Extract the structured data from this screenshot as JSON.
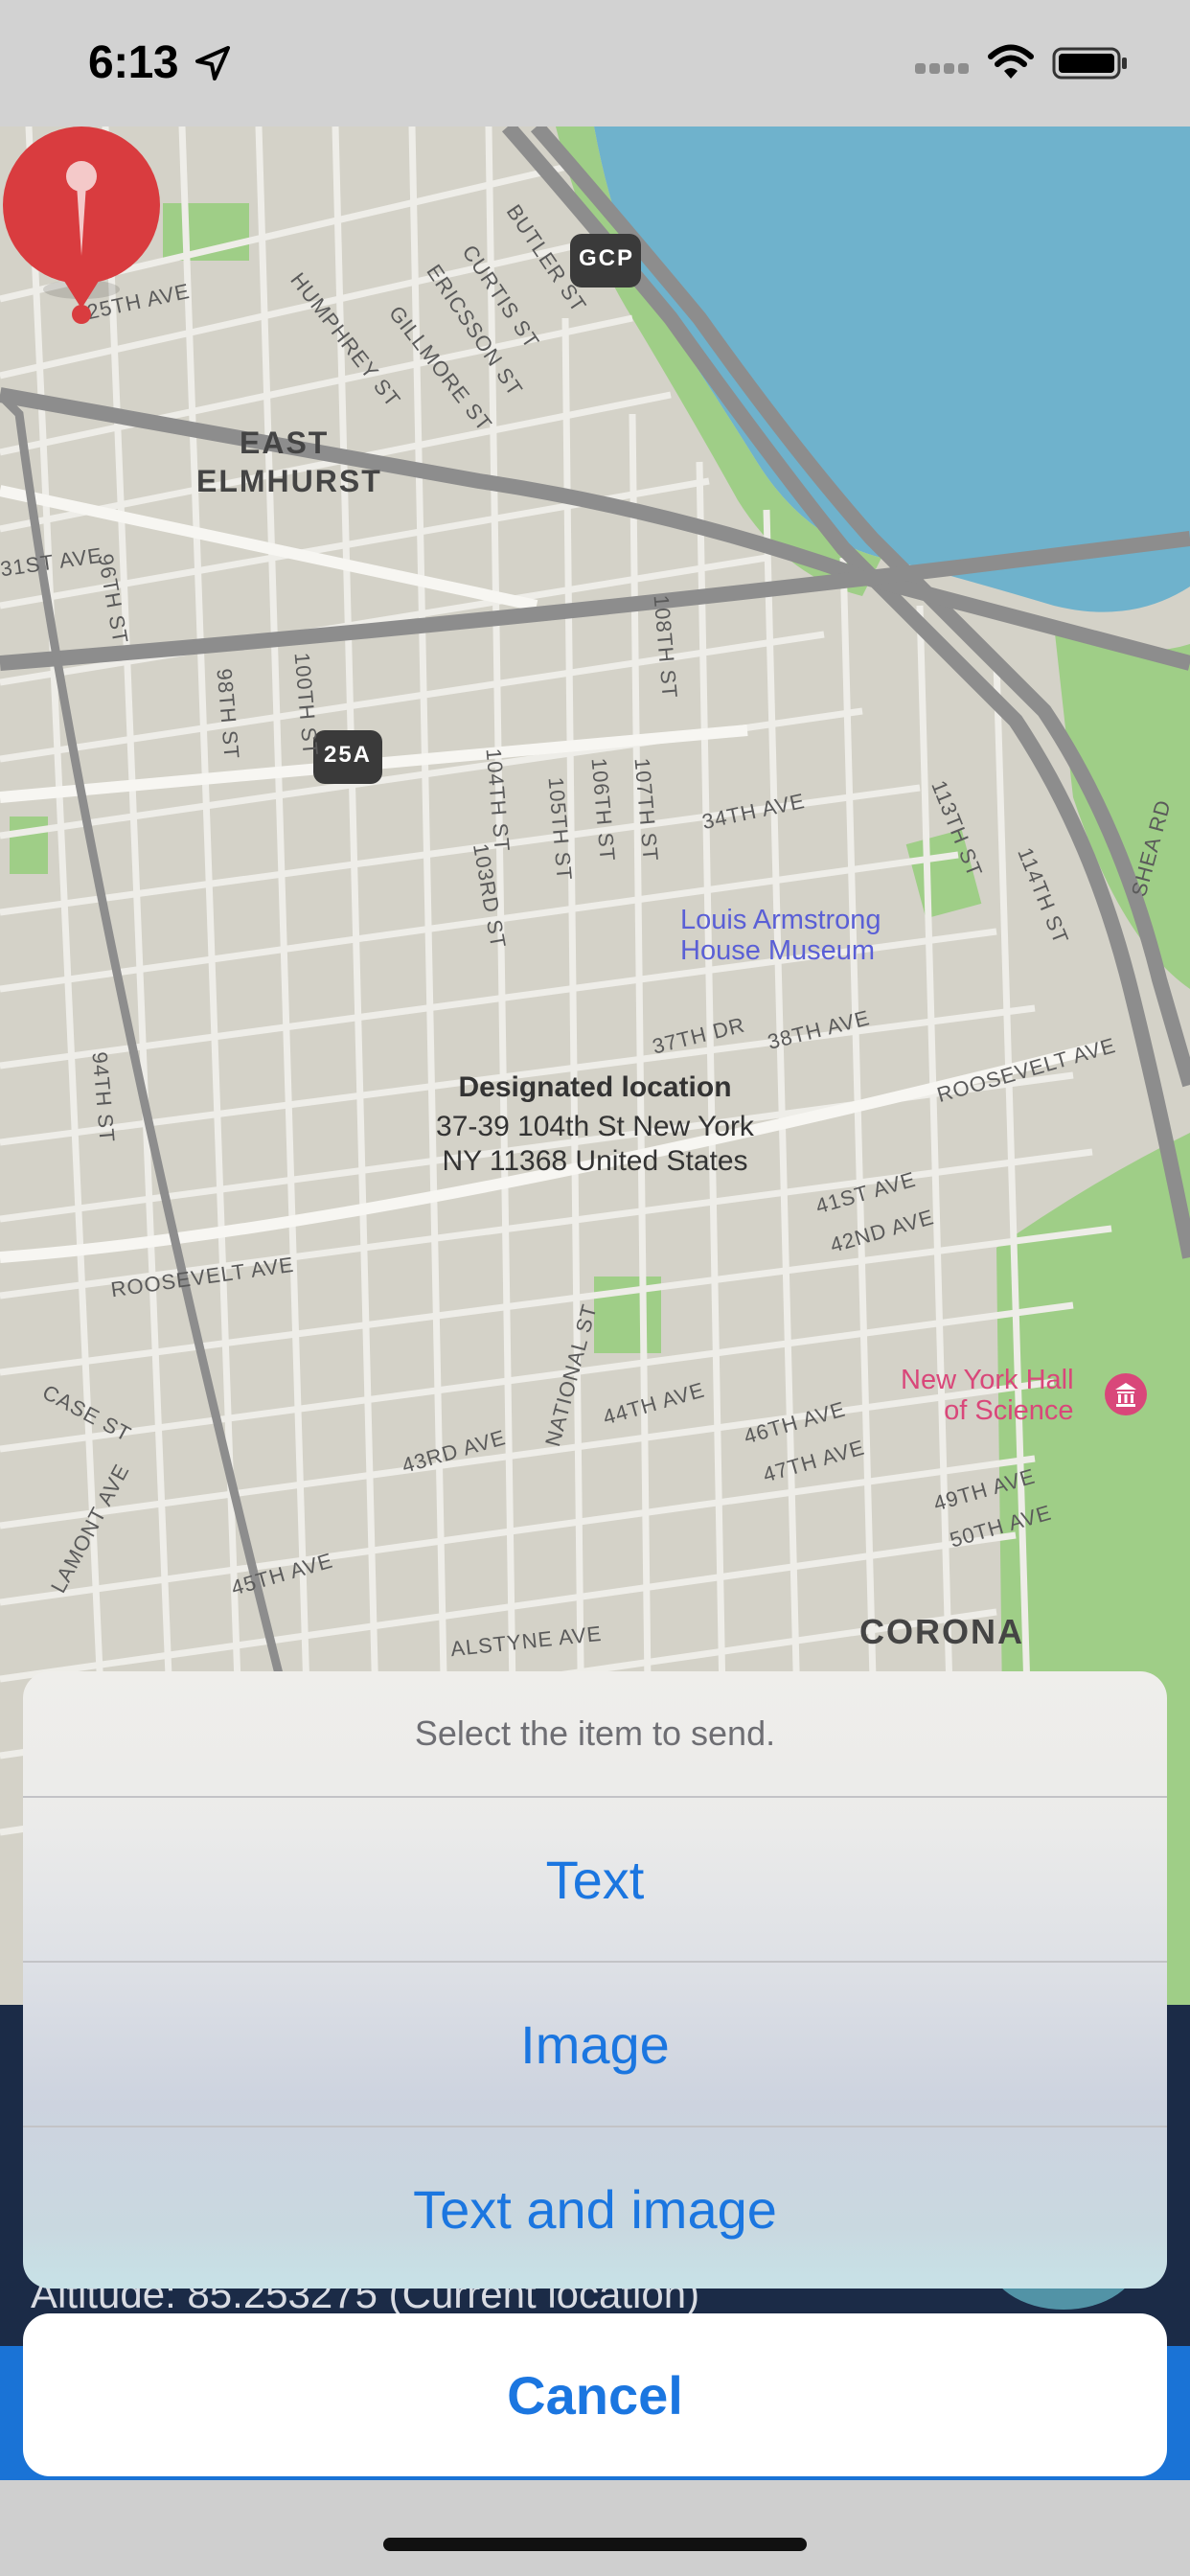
{
  "status_bar": {
    "time": "6:13"
  },
  "map": {
    "labels": {
      "25th_ave": "25TH AVE",
      "humphrey": "HUMPHREY ST",
      "gillmore": "GILLMORE ST",
      "ericsson": "ERICSSON ST",
      "curtis": "CURTIS ST",
      "butler": "BUTLER ST",
      "east_elmhurst_1": "EAST",
      "east_elmhurst_2": "ELMHURST",
      "96th_st": "96TH ST",
      "31st_ave": "31ST AVE",
      "100th_st": "100TH ST",
      "98th_st": "98TH ST",
      "104th_st": "104TH ST",
      "108th_st": "108TH ST",
      "107th_st": "107TH ST",
      "106th_st": "106TH ST",
      "105th_st": "105TH ST",
      "34th_ave": "34TH AVE",
      "103rd_st": "103RD ST",
      "113th_st": "113TH ST",
      "114th_st": "114TH ST",
      "shea_rd": "SHEA RD",
      "37th_dr": "37TH DR",
      "38th_ave": "38TH AVE",
      "roosevelt_1": "ROOSEVELT AVE",
      "roosevelt_2": "ROOSEVELT AVE",
      "94th_st": "94TH ST",
      "41st_ave": "41ST AVE",
      "42nd_ave": "42ND AVE",
      "case_st": "CASE ST",
      "national_st": "NATIONAL ST",
      "44th_ave": "44TH AVE",
      "43rd_ave": "43RD AVE",
      "46th_ave": "46TH AVE",
      "47th_ave": "47TH AVE",
      "49th_ave": "49TH AVE",
      "50th_ave": "50TH AVE",
      "lamont": "LAMONT AVE",
      "45th_ave": "45TH AVE",
      "alstyne": "ALSTYNE AVE",
      "corona": "CORONA",
      "gcp": "GCP",
      "25a": "25A"
    },
    "poi": {
      "louis_1": "Louis Armstrong",
      "louis_2": "House Museum",
      "nyhs_1": "New York Hall",
      "nyhs_2": "of Science"
    },
    "pin": {
      "title": "Designated location",
      "address_line1": "37-39 104th St New York",
      "address_line2": "NY 11368 United States"
    }
  },
  "background_app": {
    "altitude": "Altitude: 85.253275 (Current location)"
  },
  "action_sheet": {
    "title": "Select the item to send.",
    "options": [
      "Text",
      "Image",
      "Text and image"
    ],
    "cancel": "Cancel"
  },
  "colors": {
    "accent": "#1b76e0",
    "pin": "#d93c3f",
    "water": "#6fb2cc",
    "park": "#9fce87"
  }
}
